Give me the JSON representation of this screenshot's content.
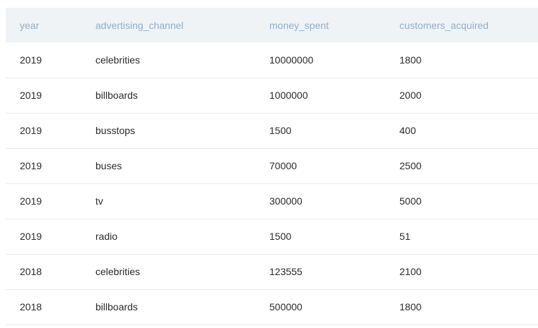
{
  "table": {
    "columns": [
      "year",
      "advertising_channel",
      "money_spent",
      "customers_acquired"
    ],
    "rows": [
      [
        "2019",
        "celebrities",
        "10000000",
        "1800"
      ],
      [
        "2019",
        "billboards",
        "1000000",
        "2000"
      ],
      [
        "2019",
        "busstops",
        "1500",
        "400"
      ],
      [
        "2019",
        "buses",
        "70000",
        "2500"
      ],
      [
        "2019",
        "tv",
        "300000",
        "5000"
      ],
      [
        "2019",
        "radio",
        "1500",
        "51"
      ],
      [
        "2018",
        "celebrities",
        "123555",
        "2100"
      ],
      [
        "2018",
        "billboards",
        "500000",
        "1800"
      ]
    ]
  }
}
